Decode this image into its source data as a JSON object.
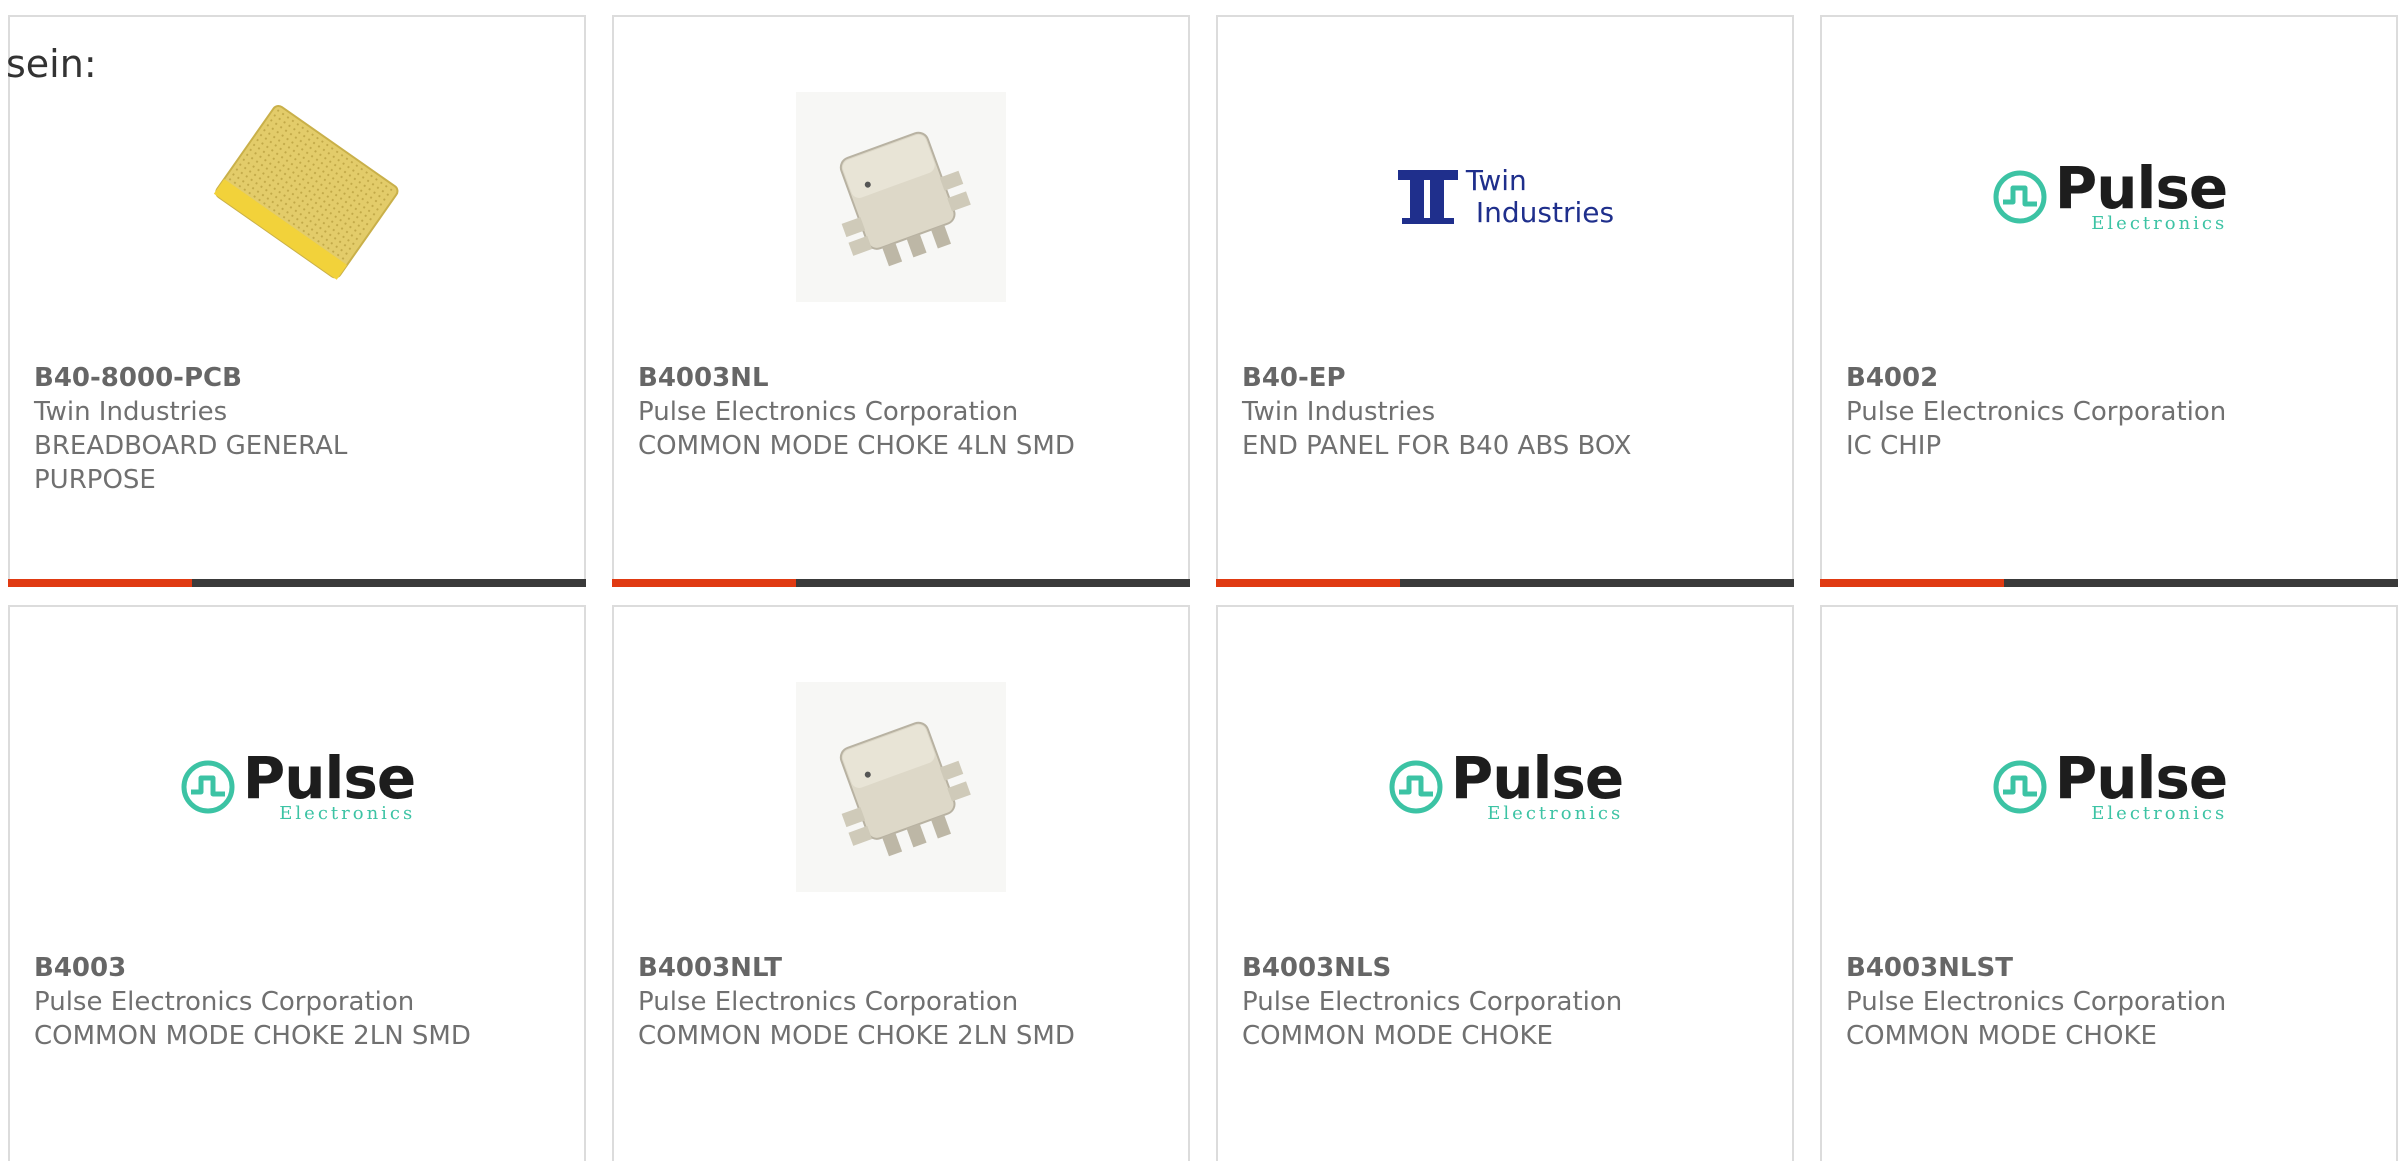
{
  "intro_text": "sein:",
  "accent_color": "#e03a12",
  "bar_color": "#3a3a3a",
  "products": [
    {
      "part": "B40-8000-PCB",
      "manufacturer": "Twin Industries",
      "description": "BREADBOARD GENERAL PURPOSE",
      "image": "breadboard-photo"
    },
    {
      "part": "B4003NL",
      "manufacturer": "Pulse Electronics Corporation",
      "description": "COMMON MODE CHOKE 4LN SMD",
      "image": "smd-choke-photo"
    },
    {
      "part": "B40-EP",
      "manufacturer": "Twin Industries",
      "description": "END PANEL FOR B40 ABS BOX",
      "image": "twin-industries-logo"
    },
    {
      "part": "B4002",
      "manufacturer": "Pulse Electronics Corporation",
      "description": "IC CHIP",
      "image": "pulse-electronics-logo"
    },
    {
      "part": "B4003",
      "manufacturer": "Pulse Electronics Corporation",
      "description": "COMMON MODE CHOKE 2LN SMD",
      "image": "pulse-electronics-logo"
    },
    {
      "part": "B4003NLT",
      "manufacturer": "Pulse Electronics Corporation",
      "description": "COMMON MODE CHOKE 2LN SMD",
      "image": "smd-choke-photo"
    },
    {
      "part": "B4003NLS",
      "manufacturer": "Pulse Electronics Corporation",
      "description": "COMMON MODE CHOKE",
      "image": "pulse-electronics-logo"
    },
    {
      "part": "B4003NLST",
      "manufacturer": "Pulse Electronics Corporation",
      "description": "COMMON MODE CHOKE",
      "image": "pulse-electronics-logo"
    }
  ],
  "logos": {
    "pulse_word": "Pulse",
    "pulse_sub": "Electronics",
    "twin_line1": "Twin",
    "twin_line2": "Industries"
  }
}
